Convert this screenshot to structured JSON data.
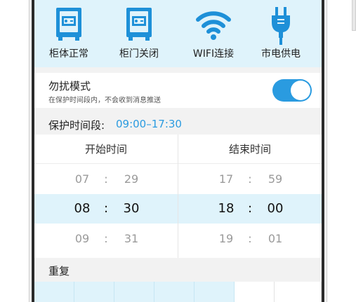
{
  "status_items": [
    {
      "label": "柜体正常",
      "icon": "cabinet-icon"
    },
    {
      "label": "柜门关闭",
      "icon": "cabinet-door-icon"
    },
    {
      "label": "WIFI连接",
      "icon": "wifi-icon"
    },
    {
      "label": "市电供电",
      "icon": "power-plug-icon"
    }
  ],
  "dnd": {
    "title": "勿扰模式",
    "subtitle": "在保护时间段内，不会收到消息推送",
    "enabled": true
  },
  "protect_period": {
    "label": "保护时间段:",
    "value": "09:00–17:30"
  },
  "picker": {
    "start": {
      "header": "开始时间",
      "rows": [
        {
          "h": "07",
          "sep": ":",
          "m": "29"
        },
        {
          "h": "08",
          "sep": ":",
          "m": "30"
        },
        {
          "h": "09",
          "sep": ":",
          "m": "31"
        }
      ]
    },
    "end": {
      "header": "结束时间",
      "rows": [
        {
          "h": "17",
          "sep": ":",
          "m": "59"
        },
        {
          "h": "18",
          "sep": ":",
          "m": "00"
        },
        {
          "h": "19",
          "sep": ":",
          "m": "01"
        }
      ]
    }
  },
  "repeat": {
    "label": "重复"
  },
  "colors": {
    "accent": "#2a9be0",
    "highlight_bg": "#dff3fb",
    "icon_blue": "#1e90d8"
  }
}
